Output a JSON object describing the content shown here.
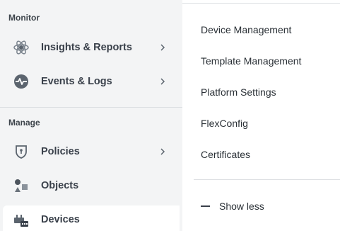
{
  "sidebar": {
    "monitor_section": "Monitor",
    "manage_section": "Manage",
    "items": [
      {
        "label": "Insights & Reports",
        "icon": "insights-icon",
        "has_chevron": true
      },
      {
        "label": "Events & Logs",
        "icon": "events-icon",
        "has_chevron": true
      },
      {
        "label": "Policies",
        "icon": "shield-icon",
        "has_chevron": true
      },
      {
        "label": "Objects",
        "icon": "objects-icon",
        "has_chevron": false
      },
      {
        "label": "Devices",
        "icon": "devices-icon",
        "has_chevron": false,
        "active": true
      }
    ]
  },
  "submenu": {
    "items": [
      "Device Management",
      "Template Management",
      "Platform Settings",
      "FlexConfig",
      "Certificates"
    ],
    "show_less": "Show less"
  }
}
